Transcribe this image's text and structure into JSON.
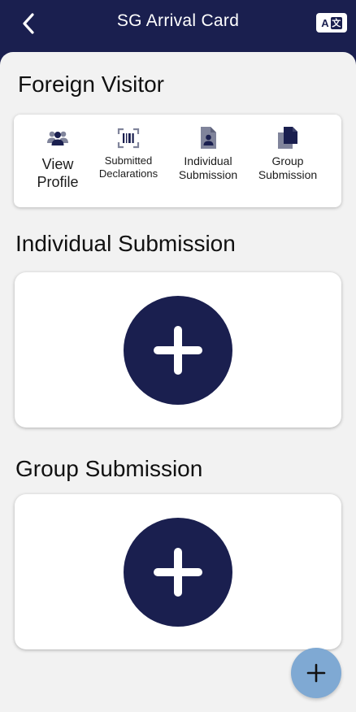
{
  "header": {
    "title": "SG Arrival Card",
    "back_icon": "chevron-left-icon",
    "lang_icon": "translate-icon",
    "lang_latin": "A",
    "lang_cjk": "文"
  },
  "visitor_section": {
    "title": "Foreign Visitor"
  },
  "quick_actions": [
    {
      "label": "View Profile",
      "icon": "users-icon"
    },
    {
      "label": "Submitted Declarations",
      "icon": "barcode-icon"
    },
    {
      "label": "Individual Submission",
      "icon": "person-document-icon"
    },
    {
      "label": "Group Submission",
      "icon": "copy-documents-icon"
    }
  ],
  "individual_section": {
    "title": "Individual Submission",
    "button_icon": "plus-icon"
  },
  "group_section": {
    "title": "Group Submission",
    "button_icon": "plus-icon"
  },
  "fab": {
    "icon": "plus-icon"
  },
  "colors": {
    "primary": "#1a1f4f",
    "background": "#f2f2f2",
    "fab": "#7fa9d3"
  }
}
